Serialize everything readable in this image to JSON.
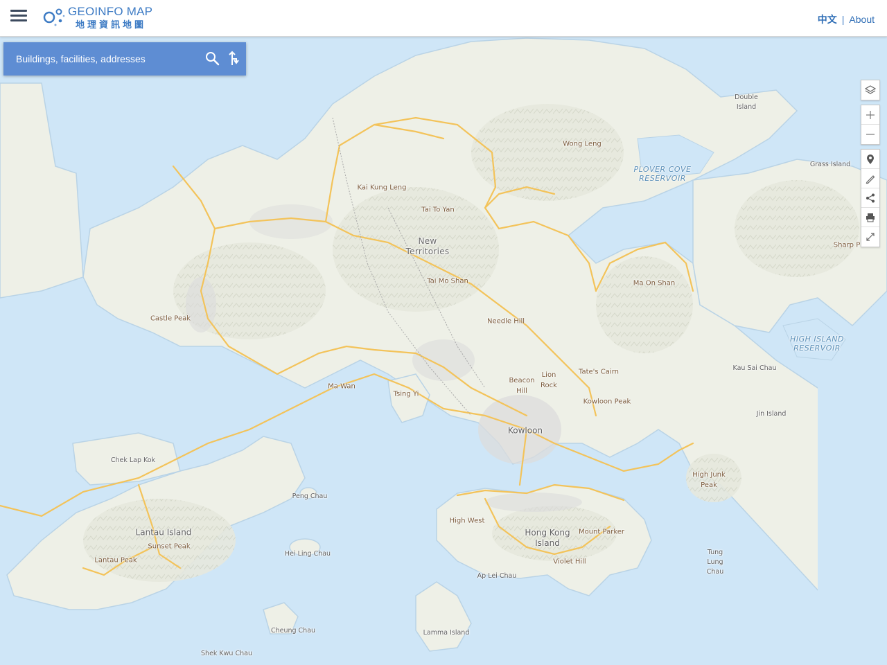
{
  "header": {
    "logo_title": "GEOINFO MAP",
    "logo_subtitle": "地理資訊地圖",
    "lang_link": "中文",
    "separator": "|",
    "about_link": "About"
  },
  "search": {
    "placeholder": "Buildings, facilities, addresses"
  },
  "toolbar": {
    "icons": [
      "layers-icon",
      "zoom-in-icon",
      "zoom-out-icon",
      "location-pin-icon",
      "measure-pencil-icon",
      "share-icon",
      "print-icon",
      "fullscreen-icon"
    ]
  },
  "colors": {
    "header_bg": "#ffffff",
    "brand_blue": "#3d7bc4",
    "search_bg": "#5e8dd3",
    "water": "#cfe6f7",
    "land": "#eef0e7",
    "road": "#f3c35a"
  },
  "map": {
    "labels": {
      "double_island": "Double\nIsland",
      "wong_leng": "Wong Leng",
      "grass_island": "Grass Island",
      "plover_cove": "PLOVER COVE\nRESERVOIR",
      "kai_kung_leng": "Kai Kung Leng",
      "tai_to_yan": "Tai To Yan",
      "new_territories": "New\nTerritories",
      "sharp_peak": "Sharp P",
      "ma_on_shan": "Ma On Shan",
      "tai_mo_shan": "Tai Mo Shan",
      "castle_peak": "Castle Peak",
      "needle_hill": "Needle Hill",
      "high_island": "HIGH ISLAND\nRESERVOIR",
      "kau_sai_chau": "Kau Sai Chau",
      "tates_cairn": "Tate's Cairn",
      "lion_rock": "Lion\nRock",
      "beacon_hill": "Beacon\nHill",
      "ma_wan": "Ma Wan",
      "tsing_yi": "Tsing Yi",
      "kowloon_peak": "Kowloon Peak",
      "jin_island": "Jin Island",
      "kowloon": "Kowloon",
      "chek_lap_kok": "Chek Lap Kok",
      "high_junk_peak": "High Junk\nPeak",
      "peng_chau": "Peng Chau",
      "high_west": "High West",
      "lantau_island": "Lantau Island",
      "hong_kong_island": "Hong Kong\nIsland",
      "mount_parker": "Mount Parker",
      "sunset_peak": "Sunset Peak",
      "hei_ling_chau": "Hei Ling Chau",
      "tung_lung_chau": "Tung\nLung\nChau",
      "lantau_peak": "Lantau Peak",
      "violet_hill": "Violet Hill",
      "ap_lei_chau": "Ap Lei Chau",
      "cheung_chau": "Cheung Chau",
      "lamma_island": "Lamma Island",
      "shek_kwu_chau": "Shek Kwu Chau"
    }
  }
}
